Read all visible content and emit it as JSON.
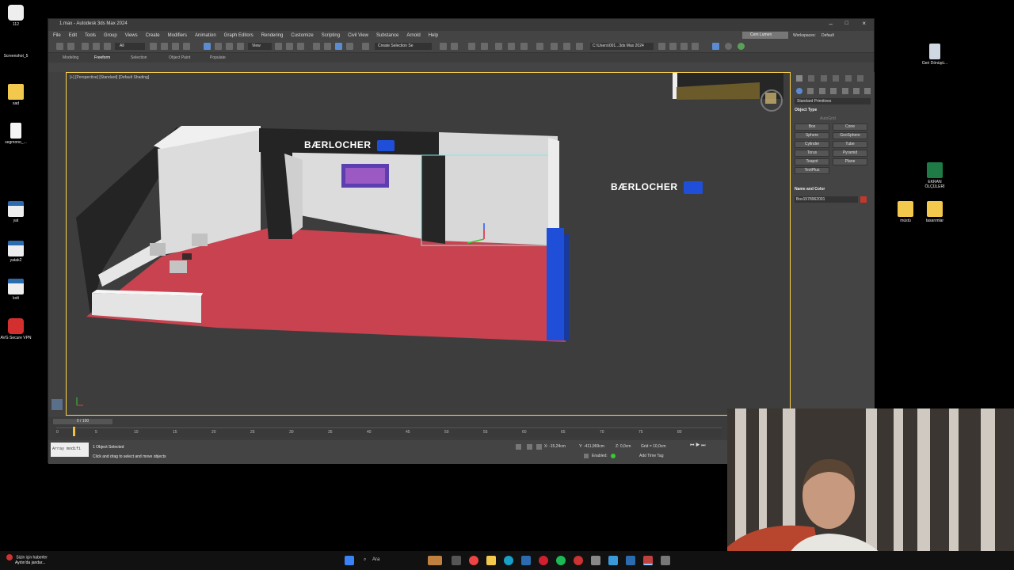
{
  "desktop": {
    "left_icons": [
      {
        "label": "112"
      },
      {
        "label": "Screenshot_5"
      },
      {
        "label": "sad"
      },
      {
        "label": "segmono_..."
      },
      {
        "label": "yat"
      },
      {
        "label": "yatak2"
      },
      {
        "label": "kolt"
      },
      {
        "label": "AVG Secure VPN"
      }
    ],
    "right_icons": [
      {
        "label": "Geri Dönüşü..."
      },
      {
        "label": "EKRAN ÖLÇÜLERİ"
      },
      {
        "label": "müstü"
      },
      {
        "label": "tasarımlar"
      }
    ],
    "colors": {
      "folder": "#f2c94c",
      "max_icon": "#2b6cb0",
      "excel": "#1e7b45",
      "avg": "#d32f2f"
    }
  },
  "window": {
    "title": "1.max - Autodesk 3ds Max 2024",
    "menu": [
      "File",
      "Edit",
      "Tools",
      "Group",
      "Views",
      "Create",
      "Modifiers",
      "Animation",
      "Graph Editors",
      "Rendering",
      "Customize",
      "Scripting",
      "Civil View",
      "Substance",
      "Arnold",
      "Help"
    ],
    "user": "Cem Lumen",
    "workspace_label": "Workspaces:",
    "workspace_value": "Default",
    "toolbar": {
      "filter": "All",
      "view": "View",
      "selection_set": "Create Selection Se",
      "path": "C:\\Users\\001...3ds Max 2024"
    },
    "ribbon_tabs": [
      "Modeling",
      "Freeform",
      "Selection",
      "Object Paint",
      "Populate"
    ],
    "viewport_label": "[+] [Perspective] [Standard] [Default Shading]",
    "scene": {
      "brand_text": "BÆRLOCHER",
      "colors": {
        "floor": "#c8424f",
        "wall": "#dadada",
        "dark": "#2b2b2b",
        "blue": "#1f4fd8",
        "selection": "#7fe8e0"
      }
    },
    "command_panel": {
      "dropdown": "Standard Primitives",
      "section_object_type": "Object Type",
      "autogrid": "AutoGrid",
      "buttons": [
        "Box",
        "Cone",
        "Sphere",
        "GeoSphere",
        "Cylinder",
        "Tube",
        "Torus",
        "Pyramid",
        "Teapot",
        "Plane",
        "TextPlus"
      ],
      "section_name_color": "Name and Color",
      "object_name": "Box1578962091",
      "object_color": "#c0392b"
    },
    "timeline": {
      "frame_counter": "0 / 100",
      "ticks": [
        "0",
        "5",
        "10",
        "15",
        "20",
        "25",
        "30",
        "35",
        "40",
        "45",
        "50",
        "55",
        "60",
        "65",
        "70",
        "75",
        "80"
      ]
    },
    "status": {
      "maxscript": "Array modifi",
      "selected": "1 Object Selected",
      "hint": "Click and drag to select and move objects",
      "x": "X: -15,24cm",
      "y": "Y: -411,969cm",
      "z": "Z: 0,0cm",
      "grid": "Grid = 10,0cm",
      "enabled": "Enabled:",
      "add_time_tag": "Add Time Tag"
    }
  },
  "taskbar": {
    "news_line1": "Sizin için haberler",
    "news_line2": "Aydın'da jandar...",
    "search": "Ara"
  }
}
